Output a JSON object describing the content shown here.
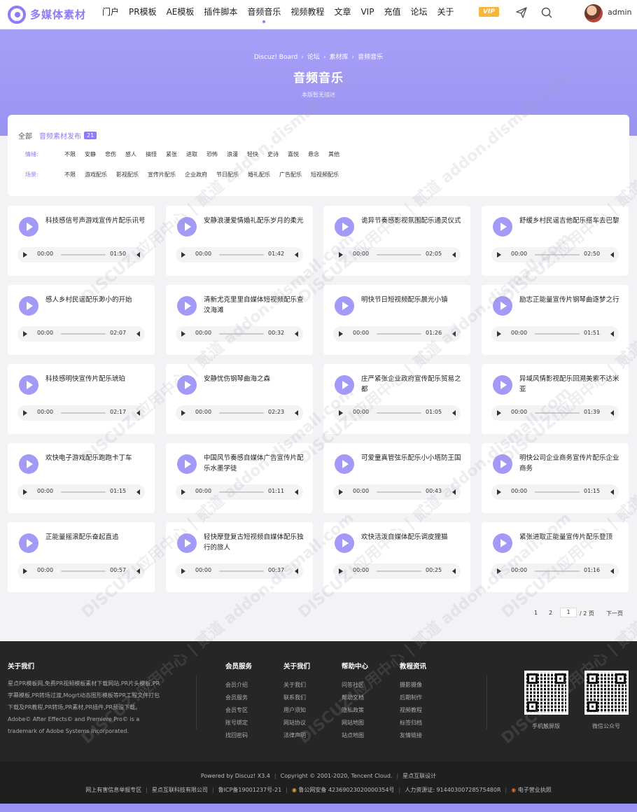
{
  "header": {
    "logo_text": "多媒体素材",
    "nav": [
      "门户",
      "PR模板",
      "AE模板",
      "插件脚本",
      "音频音乐",
      "视频教程",
      "文章",
      "VIP",
      "充值",
      "论坛",
      "关于"
    ],
    "vip_badge": "VIP",
    "username": "admin"
  },
  "banner": {
    "breadcrumb": [
      "Discuz! Board",
      "论坛",
      "素材库",
      "音频音乐"
    ],
    "title": "音频音乐",
    "subtitle": "本版暂无描述"
  },
  "filter": {
    "all_label": "全部",
    "category_label": "音频素材发布",
    "category_count": "21",
    "mood_label": "情绪:",
    "mood_options": [
      "不限",
      "安静",
      "悲伤",
      "感人",
      "搞怪",
      "紧张",
      "进取",
      "恐怖",
      "浪漫",
      "轻快",
      "史诗",
      "喜悦",
      "悬念",
      "其他"
    ],
    "scene_label": "场景:",
    "scene_options": [
      "不限",
      "游戏配乐",
      "影视配乐",
      "宣传片配乐",
      "企业政府",
      "节日配乐",
      "婚礼配乐",
      "广告配乐",
      "短视频配乐"
    ]
  },
  "tracks": [
    {
      "title": "科技感信号声游戏宣传片配乐讯号",
      "current": "00:00",
      "duration": "01:50"
    },
    {
      "title": "安静浪漫爱情婚礼配乐岁月的柔光",
      "current": "00:00",
      "duration": "01:42"
    },
    {
      "title": "诡异节奏感影视氛围配乐通灵仪式",
      "current": "00:00",
      "duration": "02:05"
    },
    {
      "title": "舒缓乡村民谣吉他配乐搭车去巴黎",
      "current": "00:00",
      "duration": "02:50"
    },
    {
      "title": "感人乡村民谣配乐渺小的开始",
      "current": "00:00",
      "duration": "02:07"
    },
    {
      "title": "清新尤克里里自媒体短视频配乐查汶海滩",
      "current": "00:00",
      "duration": "00:32"
    },
    {
      "title": "明快节日短视频配乐晨光小镇",
      "current": "00:00",
      "duration": "01:26"
    },
    {
      "title": "励志正能量宣传片钢琴曲逐梦之行",
      "current": "00:00",
      "duration": "01:51"
    },
    {
      "title": "科技感明快宣传片配乐琥珀",
      "current": "00:00",
      "duration": "02:17"
    },
    {
      "title": "安静忧伤钢琴曲海之森",
      "current": "00:00",
      "duration": "02:23"
    },
    {
      "title": "庄严紧张企业政府宣传配乐贸易之都",
      "current": "00:00",
      "duration": "01:05"
    },
    {
      "title": "异域风情影视配乐回溯美索不达米亚",
      "current": "00:00",
      "duration": "01:39"
    },
    {
      "title": "欢快电子游戏配乐跑跑卡丁车",
      "current": "00:00",
      "duration": "01:15"
    },
    {
      "title": "中国风节奏感自媒体广告宣传片配乐水墨学徒",
      "current": "00:00",
      "duration": "01:11"
    },
    {
      "title": "可爱童真管弦乐配乐小小塔防王国",
      "current": "00:00",
      "duration": "00:43"
    },
    {
      "title": "明快公司企业商务宣传片配乐企业商务",
      "current": "00:00",
      "duration": "01:15"
    },
    {
      "title": "正能量摇滚配乐奋起直追",
      "current": "00:00",
      "duration": "00:57"
    },
    {
      "title": "轻快摩登复古短视频自媒体配乐独行的旅人",
      "current": "00:00",
      "duration": "00:37"
    },
    {
      "title": "欢快活泼自媒体配乐调皮狸猫",
      "current": "00:00",
      "duration": "00:25"
    },
    {
      "title": "紧张进取正能量宣传片配乐登顶",
      "current": "00:00",
      "duration": "01:16"
    }
  ],
  "pagination": {
    "pages": [
      "1",
      "2"
    ],
    "input_value": "1",
    "total": "/ 2 页",
    "next": "下一页"
  },
  "footer": {
    "about_title": "关于我们",
    "about_text": "星点PR模板网,免费PR视频模板素材下载网站.PR片头模板,PR字幕模板,PR转场过渡,Mogrt动态图形模板等PR工程文件打包下载及PR教程,PR转场,PR素材,PR插件,PR预设下载。Adobe© After Effects© and Premiere Pro© is a trademark of Adobe Systems Incorporated.",
    "columns": [
      {
        "title": "会员服务",
        "links": [
          "会员介绍",
          "会员服务",
          "会员专区",
          "账号绑定",
          "找回密码"
        ]
      },
      {
        "title": "关于我们",
        "links": [
          "关于我们",
          "联系我们",
          "用户须知",
          "网站协议",
          "法律声明"
        ]
      },
      {
        "title": "帮助中心",
        "links": [
          "问答社区",
          "帮助文档",
          "隐私政策",
          "网站地图",
          "站点地图"
        ]
      },
      {
        "title": "教程资讯",
        "links": [
          "摄影摄像",
          "后期制作",
          "视频教程",
          "标签归档",
          "友情链接"
        ]
      }
    ],
    "qr_labels": [
      "手机触屏版",
      "微信公众号"
    ],
    "copyright_line": [
      "Powered by Discuz! X3.4",
      "Copyright © 2001-2020, Tencent Cloud.",
      "星点互联设计"
    ],
    "legal_line": [
      "网上有害信息举报专区",
      "星点互联科技有限公司",
      "鲁ICP备19001237号-21",
      "鲁公网安备 42369023020000354号",
      "人力资源证: 91440300728575480R",
      "电子营业执照"
    ]
  },
  "watermark": "DISCUZ!应用中心 | 贰道 addon.dismall.com"
}
